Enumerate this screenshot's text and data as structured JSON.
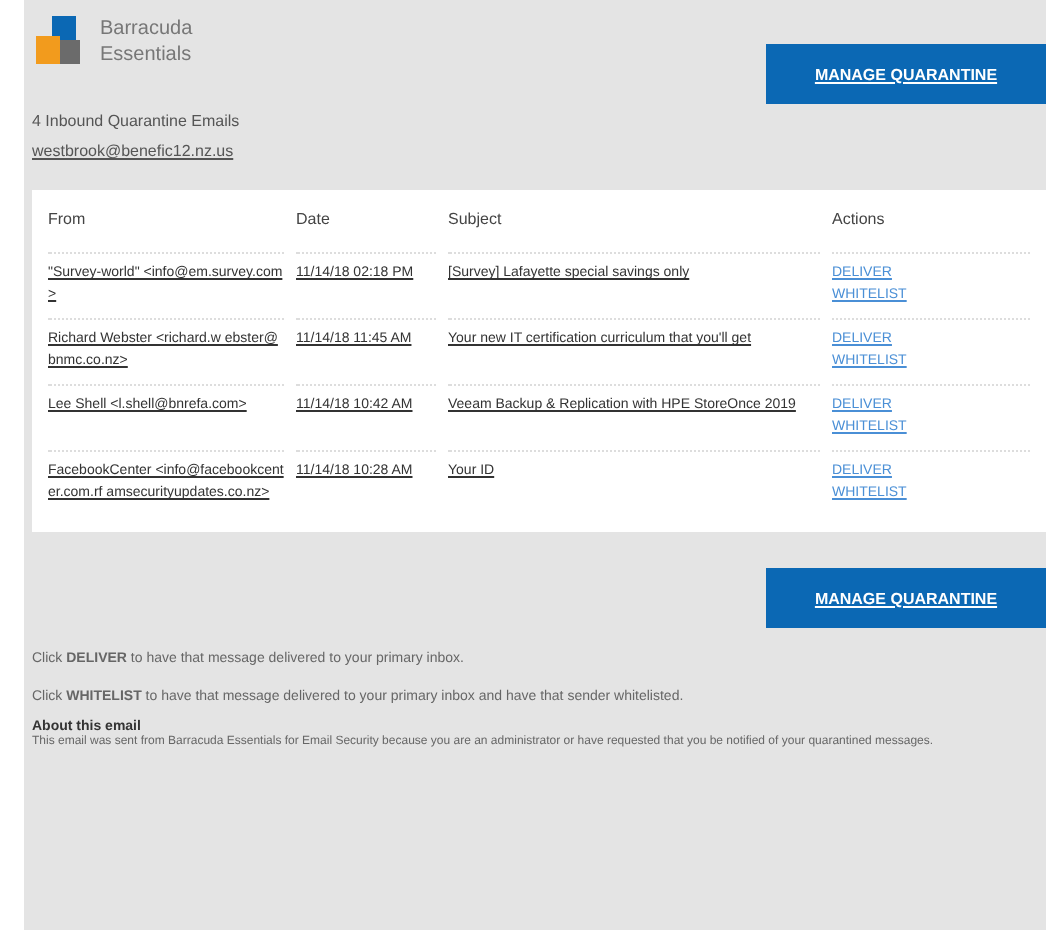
{
  "header": {
    "logo_line1": "Barracuda",
    "logo_line2": "Essentials",
    "button": "MANAGE QUARANTINE"
  },
  "summary": {
    "count": "4 Inbound Quarantine Emails",
    "address": "westbrook@benefic12.nz.us"
  },
  "table": {
    "columns": [
      "From",
      "Date",
      "Subject",
      "Actions"
    ],
    "rows": [
      {
        "from": "\"Survey-world\" <info@em.survey.com>",
        "date": "11/14/18 02:18 PM",
        "subject": "[Survey] Lafayette special savings only",
        "actions": [
          "DELIVER",
          "WHITELIST"
        ]
      },
      {
        "from": "Richard Webster <richard.w ebster@bnmc.co.nz>",
        "date": "11/14/18 11:45 AM",
        "subject": "Your new IT certification curriculum that you'll get",
        "actions": [
          "DELIVER",
          "WHITELIST"
        ]
      },
      {
        "from": "Lee Shell <l.shell@bnrefa.com>",
        "date": "11/14/18 10:42 AM",
        "subject": "Veeam Backup & Replication with HPE StoreOnce 2019",
        "actions": [
          "DELIVER",
          "WHITELIST"
        ]
      },
      {
        "from": "FacebookCenter <info@facebookcenter.com.rf amsecurityupdates.co.nz>",
        "date": "11/14/18 10:28 AM",
        "subject": "Your ID",
        "actions": [
          "DELIVER",
          "WHITELIST"
        ]
      }
    ]
  },
  "footer": {
    "button": "MANAGE QUARANTINE",
    "notes": [
      "Click **DELIVER** to have that message delivered to your primary inbox.",
      "Click **WHITELIST** to have that message delivered to your primary inbox and have that sender whitelisted."
    ],
    "about_title": "About this email",
    "about_text": "This email was sent from Barracuda Essentials for Email Security because you are an administrator or have requested that you be notified of your quarantined messages."
  }
}
